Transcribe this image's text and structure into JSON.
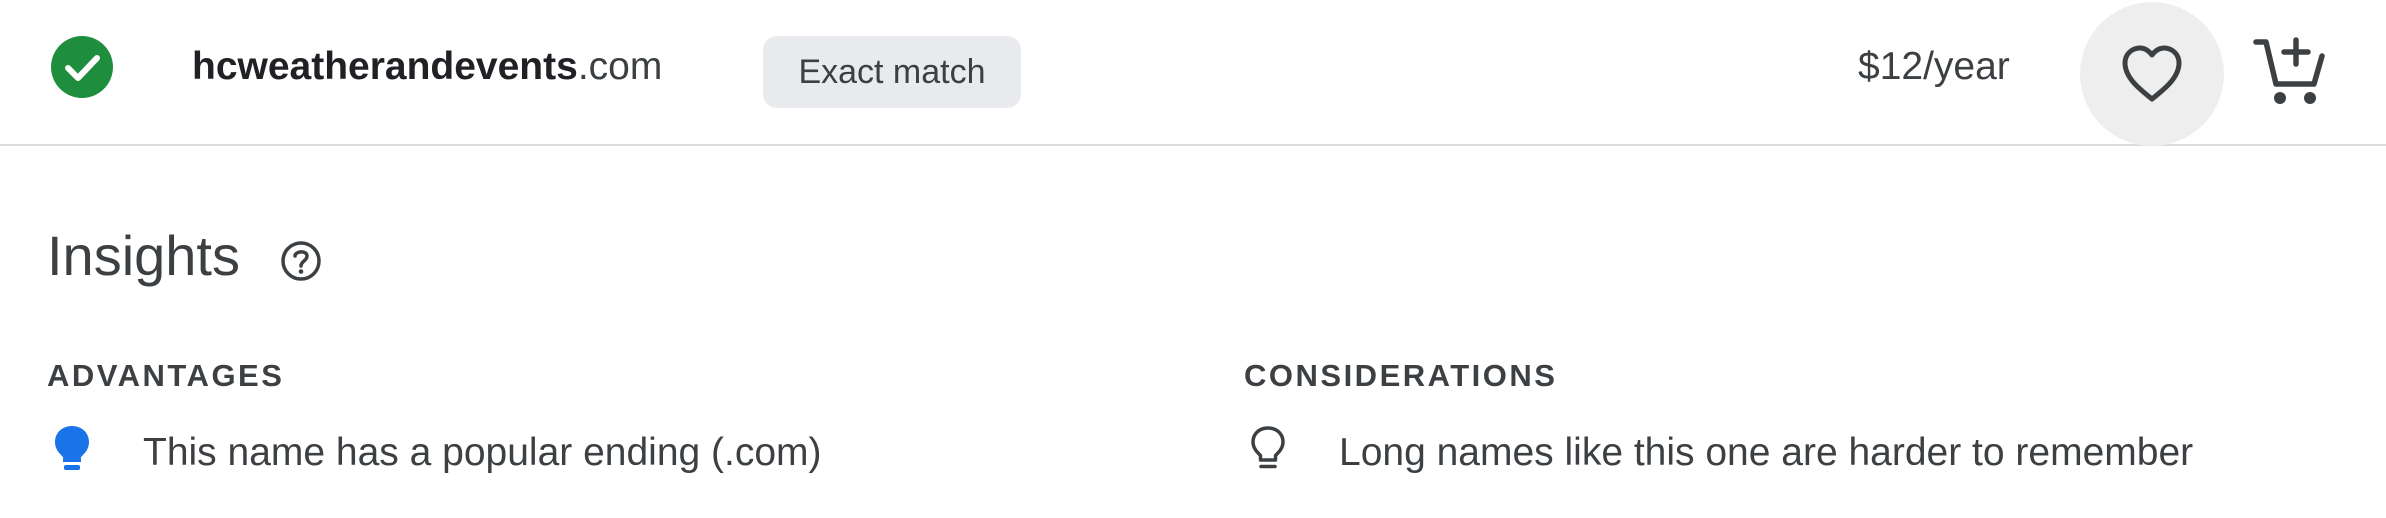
{
  "result": {
    "domain_sld": "hcweatherandevents",
    "domain_tld": ".com",
    "match_badge": "Exact match",
    "price": "$12/year",
    "status_icon": "check-circle-icon",
    "favorite_icon": "heart-icon",
    "cart_icon": "add-shopping-cart-icon",
    "status_color": "#1e8e3e"
  },
  "insights": {
    "title": "Insights",
    "help_icon": "help-circle-icon",
    "advantages": {
      "heading": "ADVANTAGES",
      "icon": "lightbulb-filled-icon",
      "icon_color": "#1a73e8",
      "items": [
        "This name has a popular ending (.com)"
      ]
    },
    "considerations": {
      "heading": "CONSIDERATIONS",
      "icon": "lightbulb-outline-icon",
      "icon_color": "#3c4043",
      "items": [
        "Long names like this one are harder to remember"
      ]
    }
  }
}
